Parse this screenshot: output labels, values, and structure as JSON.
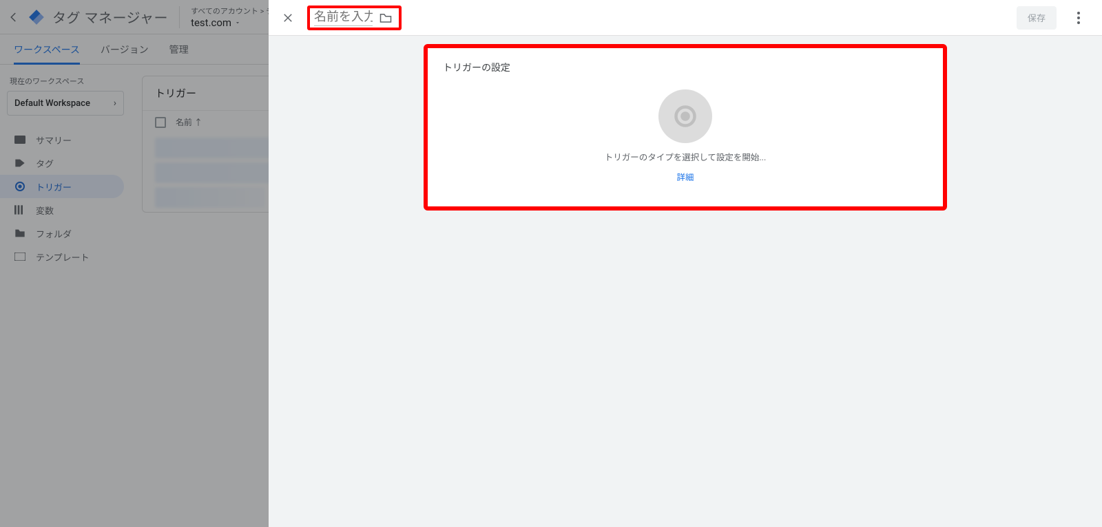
{
  "header": {
    "brand": "タグ マネージャー",
    "account_path": "すべてのアカウント > テスト",
    "account_domain": "test.com"
  },
  "tabs": {
    "workspace": "ワークスペース",
    "version": "バージョン",
    "admin": "管理"
  },
  "sidebar": {
    "ws_label": "現在のワークスペース",
    "ws_name": "Default Workspace",
    "items": {
      "summary": "サマリー",
      "tags": "タグ",
      "triggers": "トリガー",
      "variables": "変数",
      "folders": "フォルダ",
      "templates": "テンプレート"
    }
  },
  "bg_card": {
    "title": "トリガー",
    "col_name": "名前"
  },
  "panel": {
    "name_placeholder": "名前を入力",
    "save": "保存",
    "trigger_title": "トリガーの設定",
    "hint": "トリガーのタイプを選択して設定を開始...",
    "link": "詳細"
  }
}
